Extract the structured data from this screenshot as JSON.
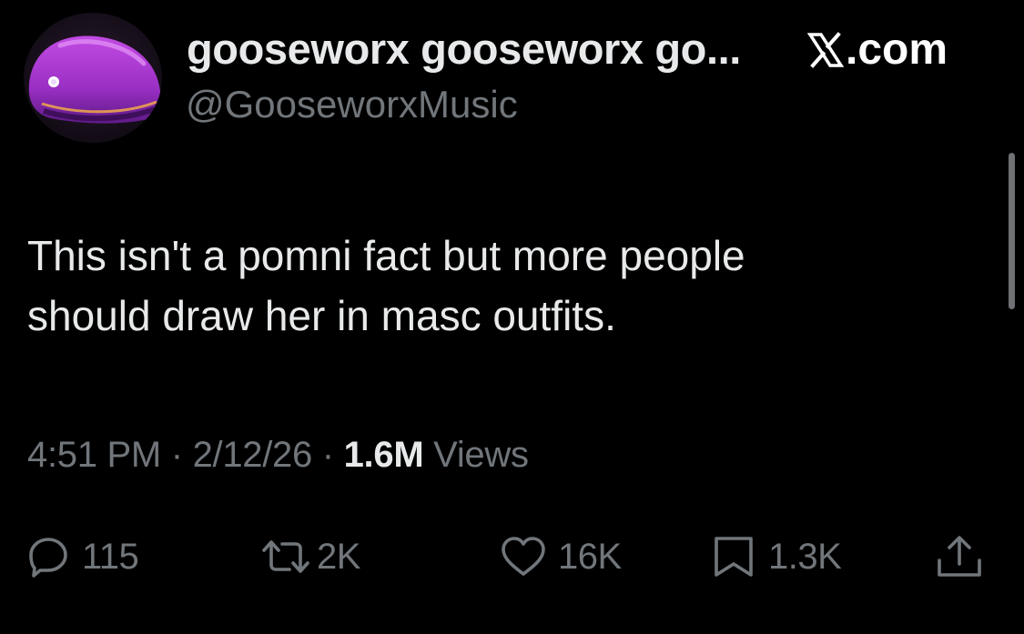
{
  "author": {
    "display_name": "gooseworx gooseworx go...",
    "handle": "@GooseworxMusic",
    "avatar_icon": "purple-creature-avatar"
  },
  "brand": {
    "label": ".com",
    "icon": "x-logo-icon"
  },
  "tweet": {
    "lines": [
      "This isn't a pomni fact but more people",
      "should draw her in masc outfits."
    ]
  },
  "meta": {
    "time": "4:51 PM",
    "separator": "·",
    "date": "2/12/26",
    "views_count": "1.6M",
    "views_label": "Views"
  },
  "actions": {
    "replies": "115",
    "reposts": "2K",
    "likes": "16K",
    "bookmarks": "1.3K"
  },
  "colors": {
    "background": "#000000",
    "primary_text": "#e7e9ea",
    "secondary_text": "#71767b",
    "avatar_accent": "#b03ad8"
  }
}
